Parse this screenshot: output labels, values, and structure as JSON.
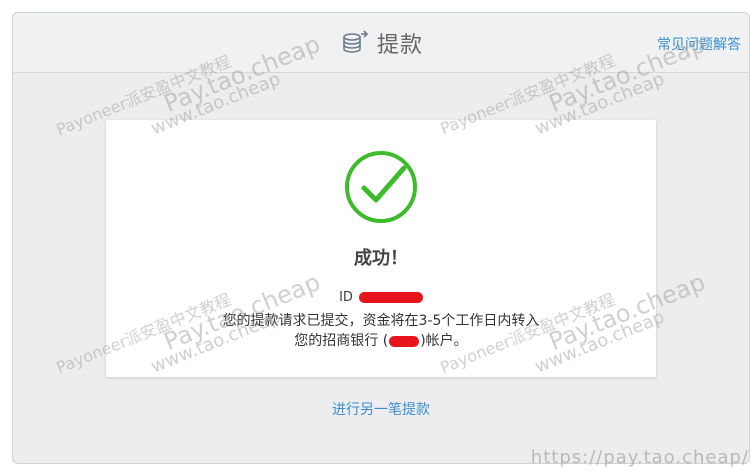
{
  "header": {
    "title": "提款",
    "faq_link": "常见问题解答",
    "icon": "coins-icon"
  },
  "card": {
    "icon": "checkmark-circle-icon",
    "success_title": "成功！",
    "id_label": "ID",
    "message_line1": "您的提款请求已提交，资金将在3-5个工作日内转入",
    "message_line2_prefix": "您的招商银行 (",
    "message_line2_suffix": ")帐户。"
  },
  "actions": {
    "another_withdrawal": "进行另一笔提款"
  },
  "watermark": {
    "brand": "Payoneer派安盈中文教程",
    "domain": "Pay.tao.cheap",
    "www": "www.tao.cheap",
    "url": "https://pay.tao.cheap/"
  },
  "colors": {
    "accent_link": "#3a8fcb",
    "success_green": "#3dbb2a",
    "redaction": "#e8141c"
  }
}
